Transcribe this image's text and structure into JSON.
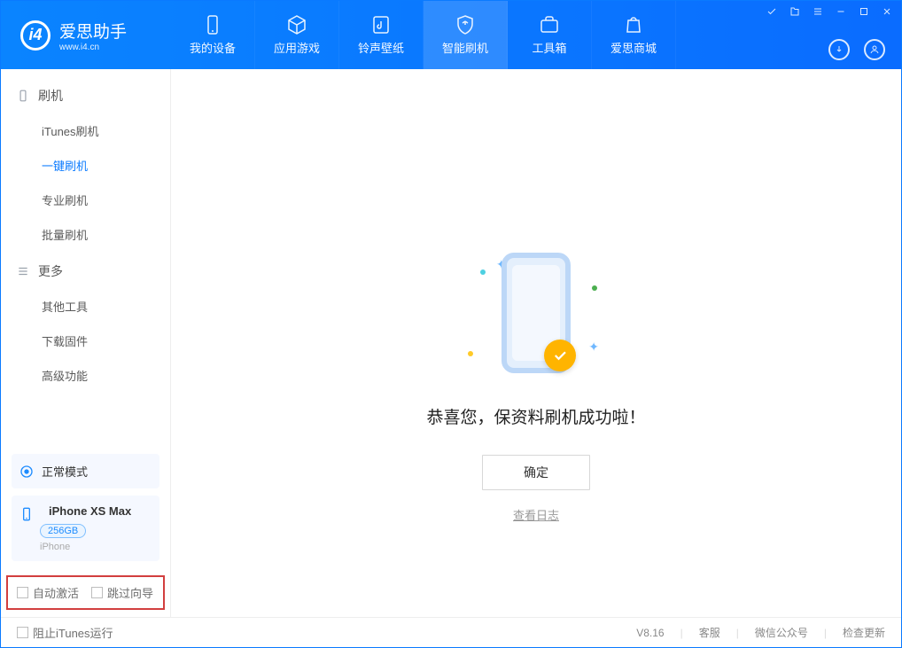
{
  "app": {
    "name_cn": "爱思助手",
    "name_en": "www.i4.cn"
  },
  "nav": [
    {
      "label": "我的设备",
      "icon": "phone"
    },
    {
      "label": "应用游戏",
      "icon": "cube"
    },
    {
      "label": "铃声壁纸",
      "icon": "music"
    },
    {
      "label": "智能刷机",
      "icon": "shield",
      "active": true
    },
    {
      "label": "工具箱",
      "icon": "briefcase"
    },
    {
      "label": "爱思商城",
      "icon": "bag"
    }
  ],
  "sidebar": {
    "sections": [
      {
        "title": "刷机",
        "key": "flash",
        "items": [
          {
            "label": "iTunes刷机"
          },
          {
            "label": "一键刷机",
            "active": true
          },
          {
            "label": "专业刷机"
          },
          {
            "label": "批量刷机"
          }
        ]
      },
      {
        "title": "更多",
        "key": "more",
        "items": [
          {
            "label": "其他工具"
          },
          {
            "label": "下载固件"
          },
          {
            "label": "高级功能"
          }
        ]
      }
    ],
    "mode": "正常模式",
    "device": {
      "name": "iPhone XS Max",
      "capacity": "256GB",
      "type": "iPhone"
    },
    "options": {
      "auto_activate": "自动激活",
      "skip_guide": "跳过向导"
    }
  },
  "content": {
    "success_title": "恭喜您，保资料刷机成功啦！",
    "confirm": "确定",
    "view_log": "查看日志"
  },
  "statusbar": {
    "block_itunes": "阻止iTunes运行",
    "version": "V8.16",
    "links": [
      "客服",
      "微信公众号",
      "检查更新"
    ]
  }
}
